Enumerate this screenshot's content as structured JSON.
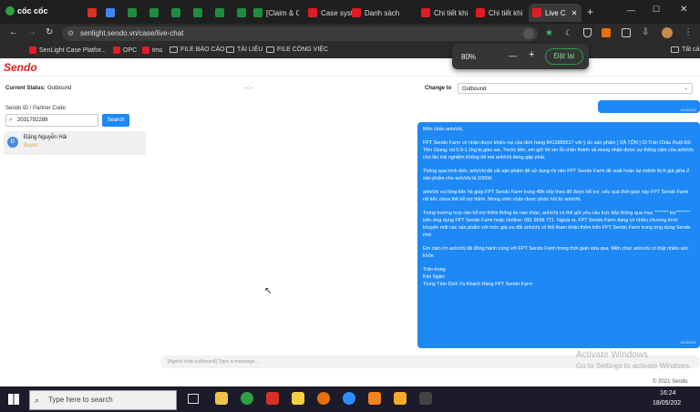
{
  "browser": {
    "brand": "cốc cốc",
    "tabs": [
      "",
      "",
      "",
      "",
      "",
      "",
      "",
      "[Claim & C",
      "Case syste",
      "Danh sách",
      "Chi tiết khi",
      "Chi tiết khi",
      "Live C"
    ],
    "url": "senlight.sendo.vn/case/live-chat",
    "bookmarks": [
      "SenLight Case Platfor...",
      "OPC",
      "tms",
      "FILE BÁO CÁO",
      "TÀI LIỆU",
      "FILE CÔNG VIỆC"
    ],
    "bookmarks_right": "Tất cả",
    "zoom": {
      "value": "80%",
      "minus": "—",
      "plus": "+",
      "reset": "Đặt lại"
    }
  },
  "app": {
    "logo": "Sendo",
    "current_status_label": "Current Status:",
    "current_status_value": "Outbound",
    "separator": "--:--",
    "change_to_label": "Change to",
    "change_to_value": "Outbound",
    "sendo_id_label": "Sendo ID / Partner Code:",
    "search_value": "2031792289",
    "search_button": "Search",
    "conversation": {
      "avatar": "Đ",
      "name": "Đặng Nguyễn Hải",
      "role": "Buyer"
    },
    "top_bubble_time": "18/05/202",
    "message": {
      "greeting": "Mến chào anh/chị,",
      "p1": "FPT Sendo Farm có nhận được khiếu nại của đơn hàng 8413985517 với ý do sản phẩm [ XÀ TÔN ] Ổi Trân Châu Ruột Đỏ Tiền Giang, túi 0.9-1.1kg bị giao sai. Trước tiên, em gửi lời xin lỗi chân thành và mong nhận được sự thông cảm của anh/chị cho lần trải nghiệm không tốt mà anh/chị đang gặp phải.",
      "p2": "Thông qua hình ảnh, anh/chị đã cắt sản phẩm để sử dụng rồi nên FPT Sendo Farm đề xuất hoàn lại chênh lệch giá giữa 2 sản phẩm cho anh/chị là 1000đ.",
      "p3": "anh/chị vui lòng liên hệ giúp FPT Sendo Farm trong 48h tiếp theo để được hỗ trợ, nếu quá thời gian này FPT Sendo Farm rất tiếc chưa thể hỗ trợ thêm. Mong sớm nhận được phản hồi từ anh/chị.",
      "p4": "Trong trường hợp cần hỗ trợ thêm thông tin nào khác, anh/chị có thể gửi yêu cầu trực tiếp thông qua mục \"\"\"\"\"\"\"\" trợ\"\"\"\"\"\"\"\" trên ứng dụng FPT Sendo Farm hoặc Hotline: 091 9696 771. Ngoài ra, FPT Sendo Farm đang có nhiều chương trình khuyến mãi các sản phẩm với mức giá ưu đãi anh/chị có thể tham khảo thêm trên FPT Sendo Farm trong ứng dụng Sendo nhé.",
      "p5": "Em cảm ơn anh/chị đã đồng hành cùng với FPT Sendo Farm trong thời gian vừa qua. Mến chúc anh/chị có thật nhiều sức khỏe.",
      "sign1": "Trân trọng",
      "sign2": "Kim Ngân",
      "sign3": "Trung Tâm Dịch Vụ Khách Hàng FPT Sendo Farm",
      "time": "18/05/202"
    },
    "composer_placeholder": "[Agent chat outbound] Type a message...",
    "footer": "© 2021 Sendo"
  },
  "watermark": {
    "title": "Activate Windows",
    "sub": "Go to Settings to activate Windows."
  },
  "taskbar": {
    "search_placeholder": "Type here to search",
    "time": "16:24",
    "date": "18/05/202"
  }
}
